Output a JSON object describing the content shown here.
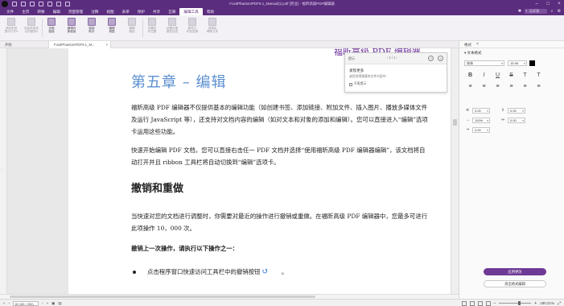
{
  "window": {
    "title": "FoxitPhantomPDF9.1_Manual(1).pdf [完业] - 福昕高级PDF编辑器"
  },
  "menubar": {
    "items": [
      "文件",
      "主页",
      "转换",
      "编辑",
      "页面管理",
      "注释",
      "视图",
      "表单",
      "保护",
      "共享",
      "互联",
      "编辑工具",
      "帮助"
    ],
    "active_index": 11,
    "search_placeholder": "告诉我..."
  },
  "ribbon": {
    "buttons": [
      {
        "label": "添加系统\n提示打开Ir",
        "on": false
      },
      {
        "label": "添加系统标\n记的新的Ir",
        "on": false
      },
      {
        "label": "页面\n链接",
        "on": true
      },
      {
        "label": "编辑对\n象链接",
        "on": true
      },
      {
        "label": "链接\n助手",
        "on": true
      },
      {
        "label": "编辑\n调整",
        "on": true
      },
      {
        "label": "编辑\n缩放",
        "on": false
      },
      {
        "label": "设置形\n状位置",
        "on": false
      },
      {
        "label": "设置对象\n属性检查",
        "on": false
      },
      {
        "label": "属性打\n印及选择",
        "on": false
      },
      {
        "label": "选择区\n域转文本",
        "on": false
      }
    ]
  },
  "tabs": {
    "start": "开始",
    "doc": "FoxitPhantomPDF9.1_M..."
  },
  "document": {
    "top_band": "福昕高级 PDF 编辑器",
    "chapter_title": "第五章 – 编辑",
    "para1": "福昕高级 PDF 编辑器不仅提供基本的编辑功能（如创建书签、添加链接、附加文件、插入图片、播放多媒体文件及运行 JavaScript 等），还支持对文档内容的编辑（如对文本和对象的添加和编辑）。您可以直接进入“编辑”选项卡运用这些功能。",
    "para2": "快速开始编辑 PDF 文档，您可以直接右击任一 PDF 文档并选择“使用福昕高级 PDF 编辑器编辑”，该文档将自动打开并且 ribbon 工具栏将自动切换到“编辑”选项卡。",
    "heading": "撤销和重做",
    "para3": "当快速对您的文档进行调整时，你需要对最近的操作进行撤销或重做。在福昕高级 PDF 编辑器中，您最多可进行此项操作 10，000 次。",
    "para4": "撤销上一次操作，请执行以下操作之一：",
    "bullet": "点击程序窗口快速访问工具栏中的撤销按钮",
    "bullet_end": "。"
  },
  "tip": {
    "title": "提示",
    "nav": "‹  1 / 1  ›",
    "line1": "发现更多",
    "line2": "或您觉得满意的文件内容中：",
    "checkbox": "不再提示"
  },
  "statusbar": {
    "page_input": "69 (69 / 250)",
    "zoom": "180.21%"
  },
  "panel": {
    "title": "格式",
    "section": "文本格式",
    "font": "宋体",
    "size": "15.98",
    "style_row": [
      "B",
      "I",
      "U",
      "S",
      "T",
      "T"
    ],
    "align_row": [
      "≡",
      "≡",
      "≡",
      "≡",
      "≡",
      "≡"
    ],
    "spacing": [
      "0.00",
      "0.00",
      "100%",
      "0.00",
      "0.00"
    ],
    "btn_primary": "应用更改",
    "btn_secondary": "退出格式编辑"
  }
}
